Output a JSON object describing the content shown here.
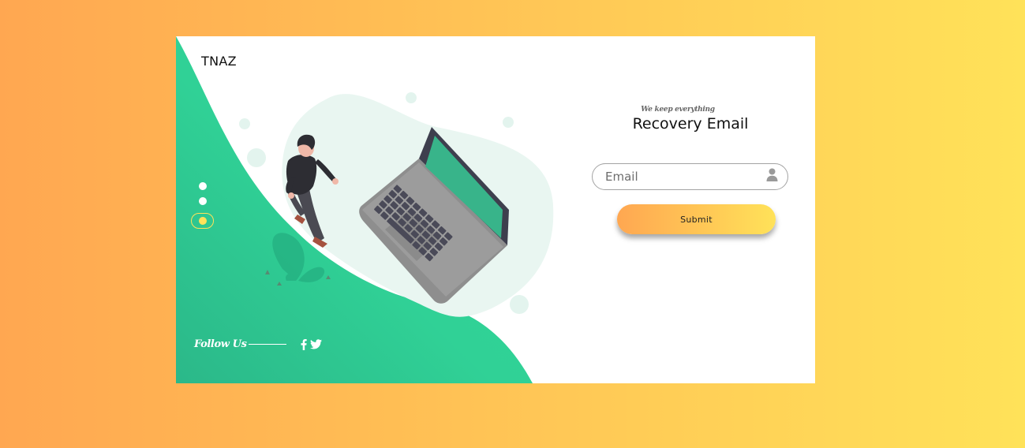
{
  "brand": {
    "name": "TNAZ"
  },
  "form": {
    "tagline": "We keep everything",
    "title": "Recovery Email",
    "email_placeholder": "Email",
    "email_value": "",
    "submit_label": "Submit"
  },
  "slider": {
    "count": 3,
    "active_index": 2
  },
  "footer": {
    "follow_label": "Follow Us",
    "social": [
      "facebook-icon",
      "twitter-icon"
    ]
  },
  "colors": {
    "page_gradient_start": "#ffa751",
    "page_gradient_end": "#ffe259",
    "accent_green": "#2fd494",
    "card_background": "#ffffff"
  }
}
